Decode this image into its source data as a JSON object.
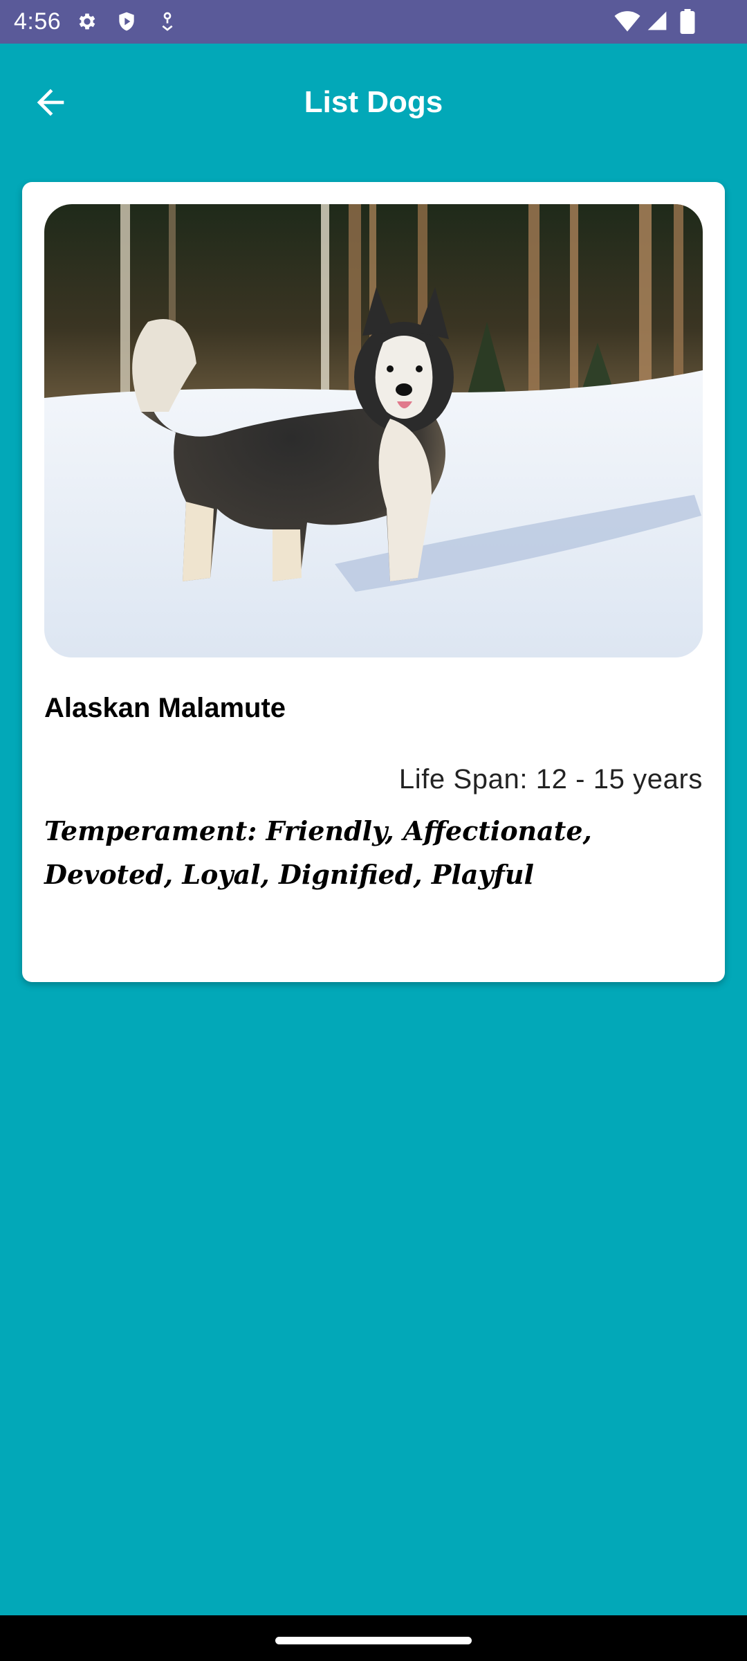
{
  "status_bar": {
    "time": "4:56",
    "icons_left": [
      "gear-icon",
      "shield-icon",
      "location-icon"
    ],
    "icons_right": [
      "wifi-icon",
      "signal-icon",
      "battery-icon"
    ]
  },
  "app_bar": {
    "title": "List Dogs",
    "back_icon": "arrow-left-icon"
  },
  "dog": {
    "name": "Alaskan Malamute",
    "life_span": "Life Span: 12 - 15 years",
    "temperament": "Temperament: Friendly, Affectionate, Devoted, Loyal, Dignified, Playful"
  },
  "colors": {
    "background": "#02a8b8",
    "status_bar": "#5a5a99",
    "card": "#ffffff",
    "nav_bar": "#000000"
  }
}
